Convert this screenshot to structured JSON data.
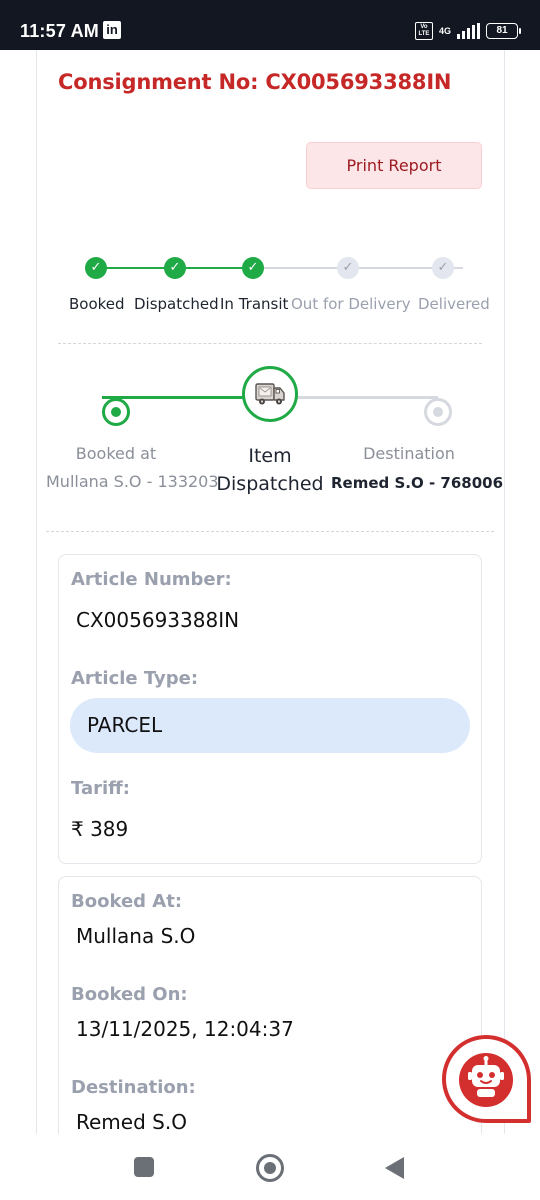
{
  "status_bar": {
    "time": "11:57 AM",
    "app_badge": "in",
    "volte": "Vo LTE",
    "network": "4G",
    "battery": "81"
  },
  "consignment": {
    "title": "Consignment No: CX005693388IN"
  },
  "actions": {
    "print_report": "Print Report"
  },
  "progress_steps": [
    {
      "label": "Booked",
      "state": "done"
    },
    {
      "label": "Dispatched",
      "state": "done"
    },
    {
      "label": "In Transit",
      "state": "done"
    },
    {
      "label": "Out for Delivery",
      "state": "todo"
    },
    {
      "label": "Delivered",
      "state": "todo"
    }
  ],
  "tracking": {
    "origin_caption": "Booked at",
    "origin_office": "Mullana S.O - 133203",
    "current_status": "Item Dispatched",
    "destination_caption": "Destination",
    "destination_office": "Remed S.O - 768006"
  },
  "article_card": {
    "article_number_label": "Article Number:",
    "article_number": "CX005693388IN",
    "article_type_label": "Article Type:",
    "article_type": "PARCEL",
    "tariff_label": "Tariff:",
    "tariff": "₹ 389"
  },
  "booking_card": {
    "booked_at_label": "Booked At:",
    "booked_at": "Mullana S.O",
    "booked_on_label": "Booked On:",
    "booked_on": "13/11/2025, 12:04:37",
    "destination_label": "Destination:",
    "destination": "Remed S.O"
  },
  "colors": {
    "accent_red": "#c62828",
    "success_green": "#1faa45",
    "pending_gray": "#9aa0ad",
    "pill_blue": "#dce9fb"
  }
}
